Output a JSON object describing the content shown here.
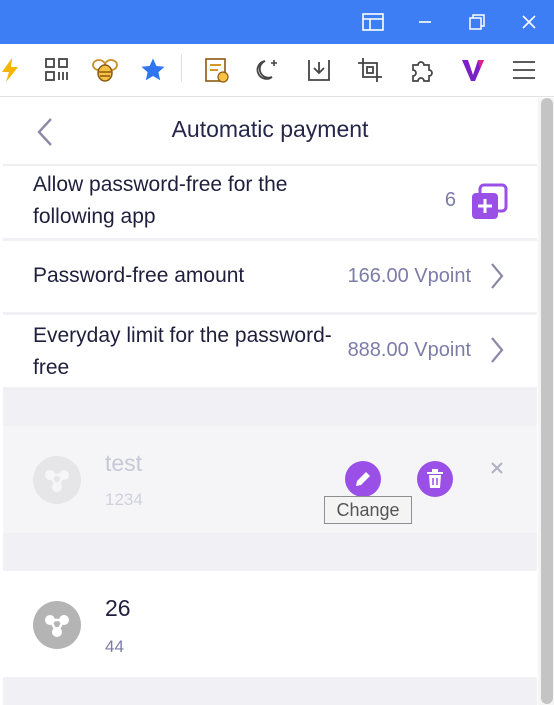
{
  "colors": {
    "titlebar": "#3d7ef5",
    "accent_purple": "#9a4fe6",
    "text_dark": "#1f1f3d",
    "text_value": "#7c7ca8",
    "panel_bg": "#f1f1f5"
  },
  "window_controls": [
    "layout-icon",
    "minimize-icon",
    "restore-icon",
    "close-icon"
  ],
  "toolbar_icons": [
    "lightning-icon",
    "apps-grid-icon",
    "bee-icon",
    "star-icon",
    "notes-icon",
    "moon-icon",
    "download-icon",
    "crop-icon",
    "puzzle-icon",
    "v-logo-icon",
    "menu-icon"
  ],
  "page": {
    "title": "Automatic payment"
  },
  "settings": {
    "allow_label": "Allow password-free for the following app",
    "allow_count": "6",
    "amount_label": "Password-free amount",
    "amount_value": "166.00 Vpoint",
    "limit_label": "Everyday limit for the password-free",
    "limit_value": "888.00 Vpoint"
  },
  "apps": [
    {
      "name": "test",
      "sub": "1234"
    },
    {
      "name": "26",
      "sub": "44"
    }
  ],
  "tooltip": {
    "text": "Change"
  }
}
